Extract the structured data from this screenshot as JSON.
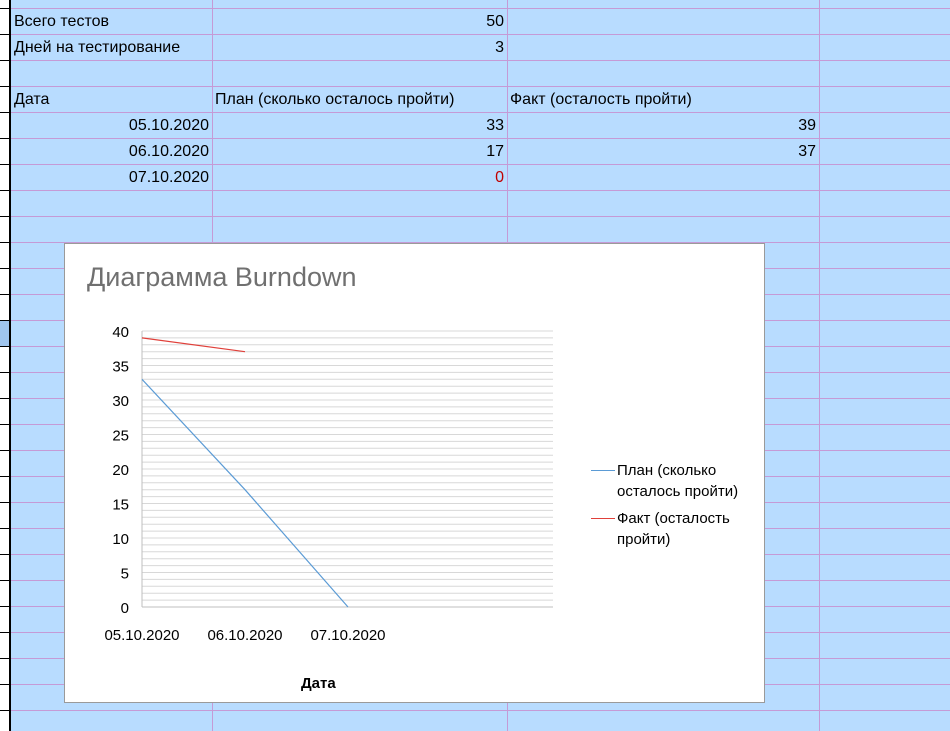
{
  "sheet": {
    "rows": [
      {
        "a": "Всего тестов",
        "b": "50",
        "c": ""
      },
      {
        "a": "Дней на тестирование",
        "b": "3",
        "c": ""
      },
      {
        "a": "",
        "b": "",
        "c": ""
      },
      {
        "a": "Дата",
        "b": "План (сколько осталось пройти)",
        "c": "Факт (осталость пройти)"
      },
      {
        "a": "05.10.2020",
        "b": "33",
        "c": "39"
      },
      {
        "a": "06.10.2020",
        "b": "17",
        "c": "37"
      },
      {
        "a": "07.10.2020",
        "b": "0",
        "c": ""
      }
    ],
    "colors": {
      "background": "#b8dcff",
      "grid": "#c59ad6",
      "negative_text": "#c00000"
    }
  },
  "chart_data": {
    "type": "line",
    "title": "Диаграмма Burndown",
    "xlabel": "Дата",
    "ylabel": "",
    "categories": [
      "05.10.2020",
      "06.10.2020",
      "07.10.2020"
    ],
    "y_ticks": [
      "0",
      "5",
      "10",
      "15",
      "20",
      "25",
      "30",
      "35",
      "40"
    ],
    "ylim": [
      0,
      40
    ],
    "grid": true,
    "legend_position": "right",
    "series": [
      {
        "name": "План (сколько осталось пройти)",
        "values": [
          33,
          17,
          0
        ],
        "color": "#5b9bd5"
      },
      {
        "name": "Факт (осталость пройти)",
        "values": [
          39,
          37,
          null
        ],
        "color": "#e0403a"
      }
    ]
  }
}
